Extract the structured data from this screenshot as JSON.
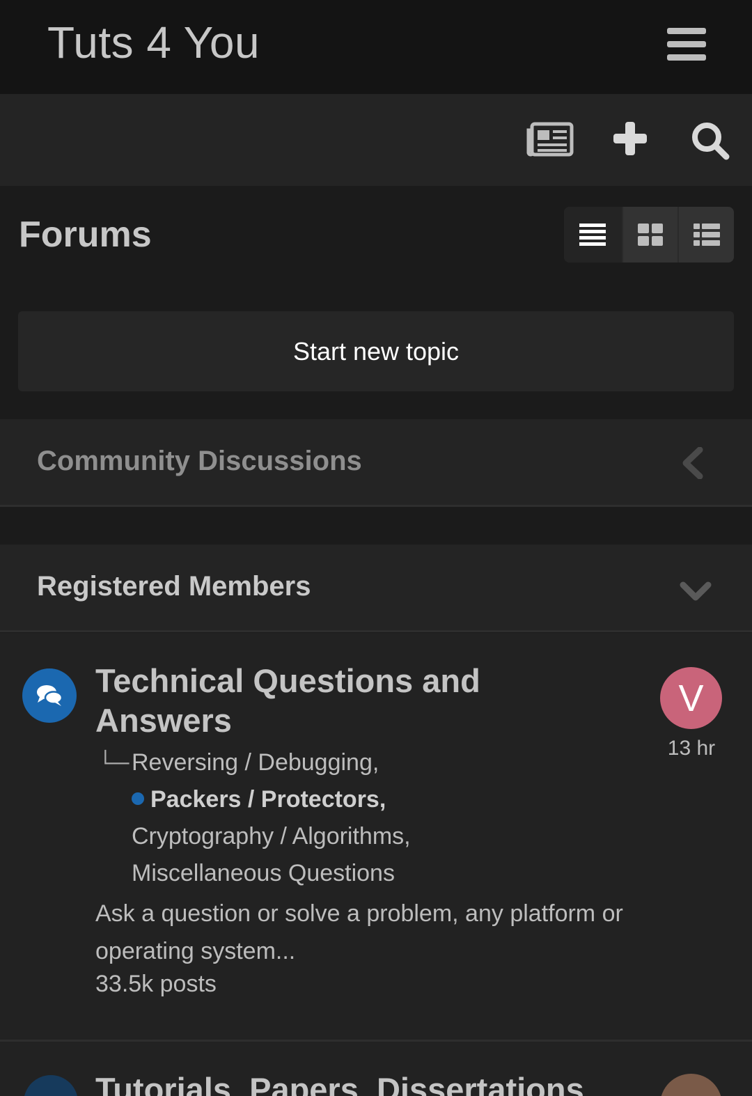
{
  "header": {
    "site_title": "Tuts 4 You"
  },
  "toolbar": {
    "icons": [
      "newspaper-icon",
      "plus-icon",
      "search-icon"
    ]
  },
  "page": {
    "title": "Forums",
    "start_topic_label": "Start new topic",
    "view_modes": [
      "table-view-icon",
      "grid-view-icon",
      "list-view-icon"
    ],
    "active_view": "table-view-icon"
  },
  "categories": [
    {
      "title": "Community Discussions",
      "toggle_icon": "chevron-left-icon"
    },
    {
      "title": "Registered Members",
      "toggle_icon": "chevron-down-icon"
    }
  ],
  "forum": {
    "title": "Technical Questions and Answers",
    "subforum_prefix": "└─",
    "subforums": [
      {
        "label": "Reversing / Debugging,",
        "unread": false
      },
      {
        "label": "Packers / Protectors,",
        "unread": true
      },
      {
        "label": "Cryptography / Algorithms,",
        "unread": false
      },
      {
        "label": "Miscellaneous Questions",
        "unread": false
      }
    ],
    "description": "Ask a question or solve a problem, any platform or operating system...",
    "posts": "33.5k posts",
    "last_poster_initial": "V",
    "last_post_time": "13 hr"
  },
  "next_forum": {
    "title": "Tutorials, Papers, Dissertations"
  },
  "colors": {
    "header_bg": "#141414",
    "toolbar_bg": "#242424",
    "page_bg": "#1b1b1b",
    "accent_blue": "#1b68b0",
    "avatar_pink": "#c9647a"
  }
}
